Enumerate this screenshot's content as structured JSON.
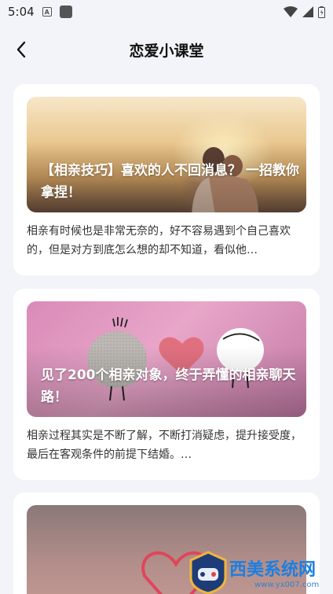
{
  "status_bar": {
    "time": "5:04",
    "notification_badge": "A"
  },
  "header": {
    "title": "恋爱小课堂",
    "back_icon": "chevron-left-icon"
  },
  "articles": [
    {
      "title": "【相亲技巧】喜欢的人不回消息？ 一招教你拿捏！",
      "summary": "相亲有时候也是非常无奈的，好不容易遇到个自己喜欢的，但是对方到底怎么想的却不知道，看似他…"
    },
    {
      "title": "见了200个相亲对象，终于弄懂的相亲聊天路！",
      "summary": "相亲过程其实是不断了解，不断打消疑虑，提升接受度，最后在客观条件的前提下结婚。…"
    },
    {
      "title": "",
      "summary": ""
    }
  ],
  "watermark": {
    "brand": "西美系统网",
    "url": "www.yx007.com"
  },
  "colors": {
    "background": "#f3f4f9",
    "card": "#ffffff",
    "watermark": "#1c7fe0"
  }
}
